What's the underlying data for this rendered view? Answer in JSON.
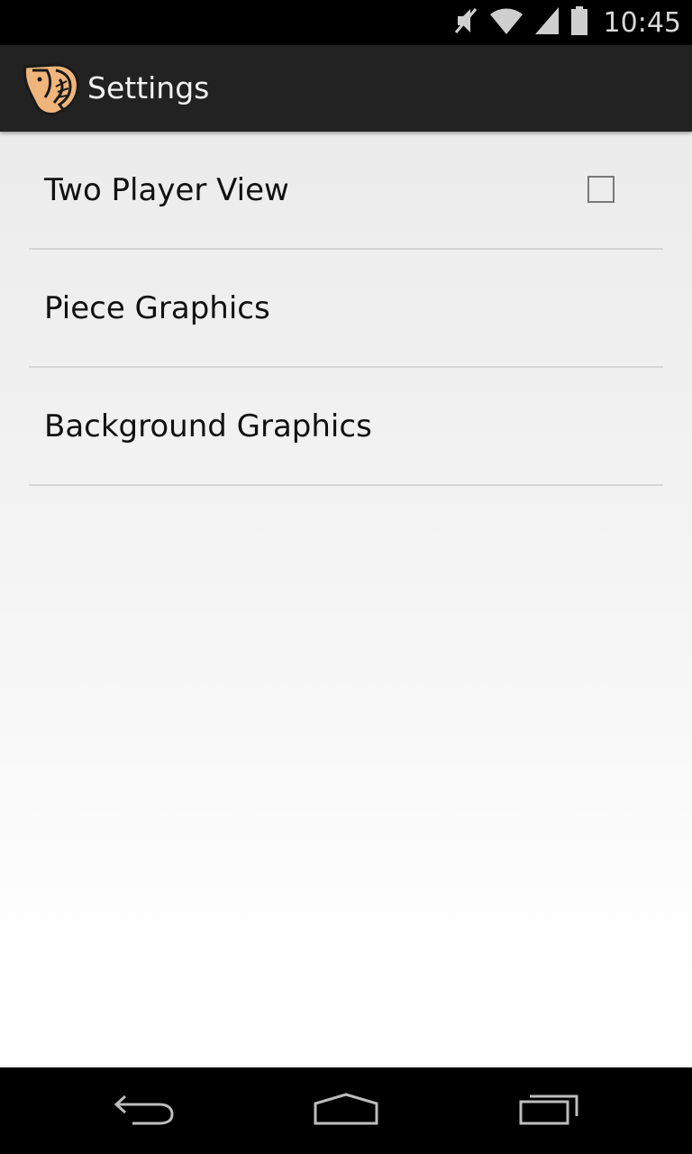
{
  "status_bar": {
    "time": "10:45",
    "icons": [
      "mute-icon",
      "wifi-icon",
      "signal-icon",
      "battery-icon"
    ]
  },
  "action_bar": {
    "title": "Settings",
    "app_icon": "elephant-logo-icon",
    "icon_color": "#f0b57a"
  },
  "preferences": {
    "items": [
      {
        "label": "Two Player View",
        "type": "checkbox",
        "checked": false
      },
      {
        "label": "Piece Graphics",
        "type": "link"
      },
      {
        "label": "Background Graphics",
        "type": "link"
      }
    ]
  },
  "nav_bar": {
    "buttons": [
      "back-icon",
      "home-icon",
      "recent-apps-icon"
    ]
  }
}
